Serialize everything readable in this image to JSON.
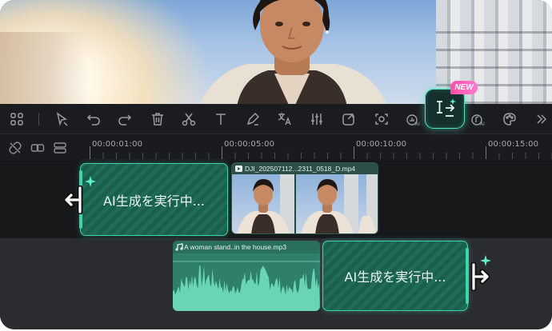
{
  "badge": {
    "label": "NEW"
  },
  "toolbar": {
    "icons": [
      "grid-icon",
      "select-arrow-icon",
      "undo-icon",
      "redo-icon",
      "delete-icon",
      "cut-icon",
      "text-icon",
      "pen-icon",
      "translate-icon",
      "audio-adjust-icon",
      "export-frame-icon",
      "ai-mask-icon",
      "ai-audio-icon",
      "ai-extend-icon",
      "ai-music-icon",
      "color-palette-icon",
      "expand-icon"
    ],
    "highlighted": "ai-extend-icon"
  },
  "ruler": {
    "ticks": [
      "00:00:01:00",
      "00:00:05:00",
      "00:00:10:00",
      "00:00:15:00"
    ]
  },
  "timeline": {
    "ai_clip_top_label": "AI生成を実行中...",
    "ai_clip_bottom_label": "AI生成を実行中...",
    "video_clip_name": "DJI_202507112...2311_0518_D.mp4",
    "audio_clip_name_main": "A woman stand..in the house",
    "audio_clip_name_ext": ".mp3"
  },
  "colors": {
    "accent": "#3fd4ae",
    "badge": "#ff5fb8",
    "background": "#1a1b1e"
  }
}
